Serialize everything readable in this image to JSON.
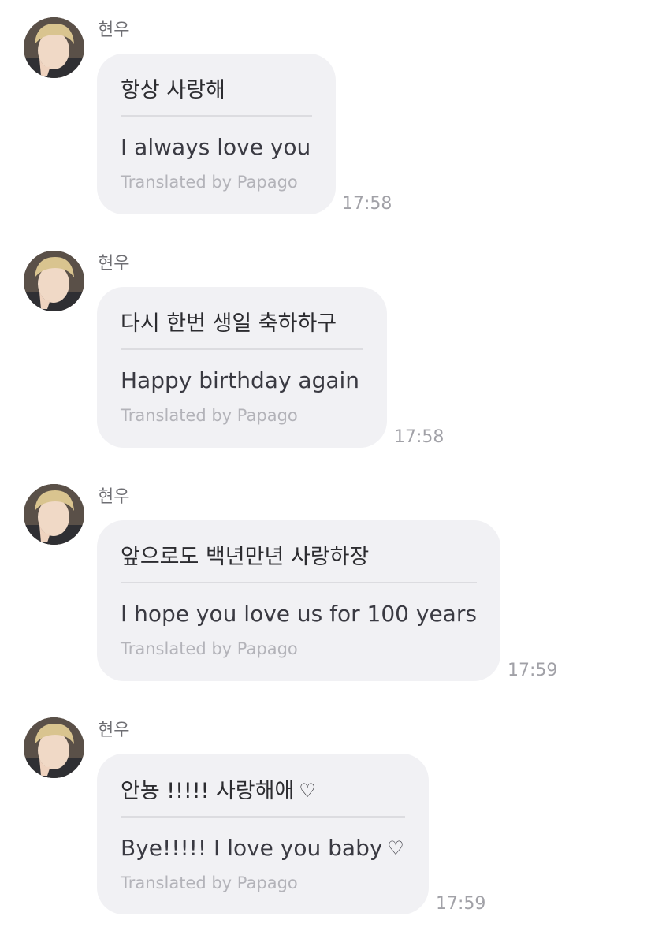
{
  "messages": [
    {
      "sender": "현우",
      "original": "항상 사랑해",
      "translated": "I always love you",
      "credit": "Translated by Papago",
      "time": "17:58"
    },
    {
      "sender": "현우",
      "original": "다시 한번 생일 축하하구",
      "translated": "Happy birthday again",
      "credit": "Translated by Papago",
      "time": "17:58"
    },
    {
      "sender": "현우",
      "original": "앞으로도 백년만년 사랑하장",
      "translated": "I hope you love us for 100 years",
      "credit": "Translated by Papago",
      "time": "17:59"
    },
    {
      "sender": "현우",
      "original": "안뇽 !!!!! 사랑해애",
      "translated": "Bye!!!!! I love you baby",
      "credit": "Translated by Papago",
      "time": "17:59",
      "icon": "heart-outline-icon"
    }
  ]
}
